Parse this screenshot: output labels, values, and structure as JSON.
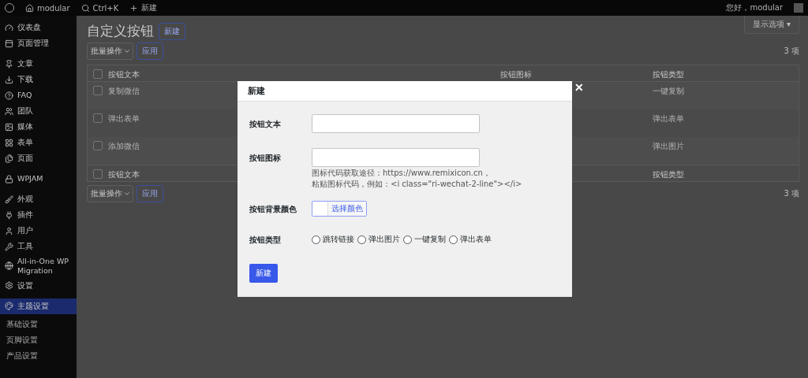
{
  "admin_bar": {
    "site": "modular",
    "search": "Ctrl+K",
    "new": "新建",
    "greeting": "您好，modular"
  },
  "sidebar": {
    "items": [
      {
        "label": "仪表盘",
        "selected": false
      },
      {
        "label": "页面管理",
        "selected": false
      },
      {
        "label": "文章",
        "selected": false
      },
      {
        "label": "下载",
        "selected": false
      },
      {
        "label": "FAQ",
        "selected": false
      },
      {
        "label": "团队",
        "selected": false
      },
      {
        "label": "媒体",
        "selected": false
      },
      {
        "label": "表单",
        "selected": false
      },
      {
        "label": "页面",
        "selected": false
      },
      {
        "label": "WPJAM",
        "selected": false
      },
      {
        "label": "外观",
        "selected": false
      },
      {
        "label": "插件",
        "selected": false
      },
      {
        "label": "用户",
        "selected": false
      },
      {
        "label": "工具",
        "selected": false
      },
      {
        "label": "All-in-One WP Migration",
        "selected": false
      },
      {
        "label": "设置",
        "selected": false
      },
      {
        "label": "主题设置",
        "selected": true
      }
    ],
    "submenu": [
      "基础设置",
      "页脚设置",
      "产品设置"
    ]
  },
  "page": {
    "title": "自定义按钮",
    "add_button": "新建",
    "screen_options": "显示选项 ▾",
    "bulk_action": "批量操作",
    "apply": "应用",
    "count": "3 项",
    "bottom_bulk_action": "批量操作",
    "bottom_apply": "应用",
    "bottom_count": "3 项"
  },
  "table": {
    "select_all_checked": false,
    "columns": [
      "按钮文本",
      "按钮图标",
      "按钮类型"
    ],
    "rows": [
      {
        "checked": false,
        "text": "复制微信",
        "type": "一键复制"
      },
      {
        "checked": false,
        "text": "弹出表单",
        "type": "弹出表单"
      },
      {
        "checked": false,
        "text": "添加微信",
        "type": "弹出图片"
      }
    ],
    "footer_select_all_checked": false,
    "footer_columns": [
      "按钮文本",
      "按钮类型"
    ]
  },
  "modal": {
    "title": "新建",
    "close": "✕",
    "fields": [
      {
        "kind": "text",
        "label": "按钮文本"
      },
      {
        "kind": "text",
        "label": "按钮图标",
        "help": [
          "图标代码获取途径：https://www.remixicon.cn，",
          "粘贴图标代码，例如：<i class=\"ri-wechat-2-line\"></i>"
        ]
      },
      {
        "kind": "color",
        "label": "按钮背景颜色",
        "button": "选择颜色"
      },
      {
        "kind": "radio",
        "label": "按钮类型",
        "options": [
          {
            "label": "跳转链接",
            "selected": false
          },
          {
            "label": "弹出图片",
            "selected": false
          },
          {
            "label": "一键复制",
            "selected": false
          },
          {
            "label": "弹出表单",
            "selected": false
          }
        ]
      }
    ],
    "submit": "新建"
  }
}
